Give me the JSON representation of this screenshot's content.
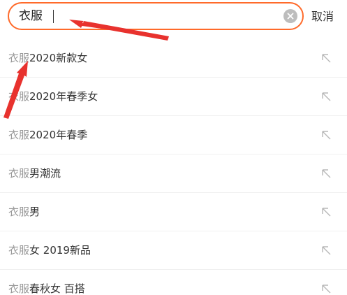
{
  "search": {
    "value": "衣服",
    "cancel_label": "取消"
  },
  "suggestions": [
    {
      "prefix": "衣服",
      "rest": "2020新款女"
    },
    {
      "prefix": "衣服",
      "rest": "2020年春季女"
    },
    {
      "prefix": "衣服",
      "rest": "2020年春季"
    },
    {
      "prefix": "衣服",
      "rest": "男潮流"
    },
    {
      "prefix": "衣服",
      "rest": "男"
    },
    {
      "prefix": "衣服",
      "rest": "女 2019新品"
    },
    {
      "prefix": "衣服",
      "rest": "春秋女 百搭"
    }
  ],
  "colors": {
    "accent": "#ff6a2a",
    "annotation_arrow": "#e8322e",
    "prefix_text": "#999999",
    "main_text": "#333333"
  },
  "icons": {
    "clear": "clear-icon",
    "fill_suggestion": "arrow-up-left-icon"
  }
}
